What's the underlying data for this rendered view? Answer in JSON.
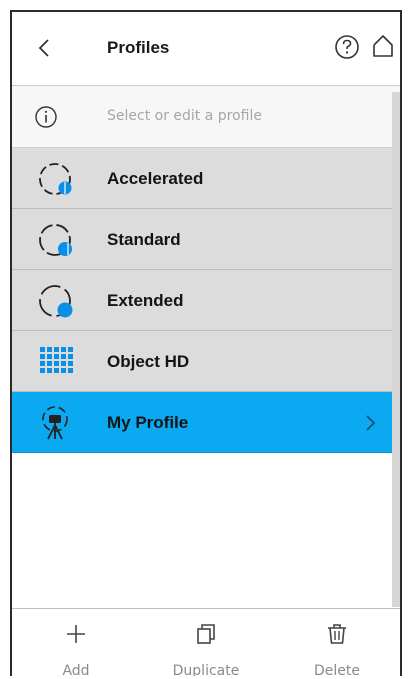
{
  "header": {
    "title": "Profiles",
    "back_icon": "chevron-left-icon",
    "help_icon": "help-circle-icon",
    "home_icon": "home-icon"
  },
  "hint": {
    "icon": "info-circle-icon",
    "text": "Select or edit a profile"
  },
  "profiles": [
    {
      "label": "Accelerated",
      "icon": "accelerated-profile-icon",
      "selected": false
    },
    {
      "label": "Standard",
      "icon": "standard-profile-icon",
      "selected": false
    },
    {
      "label": "Extended",
      "icon": "extended-profile-icon",
      "selected": false
    },
    {
      "label": "Object HD",
      "icon": "object-hd-grid-icon",
      "selected": false
    },
    {
      "label": "My Profile",
      "icon": "my-profile-scanner-icon",
      "selected": true
    }
  ],
  "toolbar": {
    "add_label": "Add",
    "duplicate_label": "Duplicate",
    "delete_label": "Delete"
  },
  "colors": {
    "selected_bg": "#0aa9f2",
    "item_bg": "#dcdcdc",
    "icon_blue": "#0a8fe8"
  }
}
